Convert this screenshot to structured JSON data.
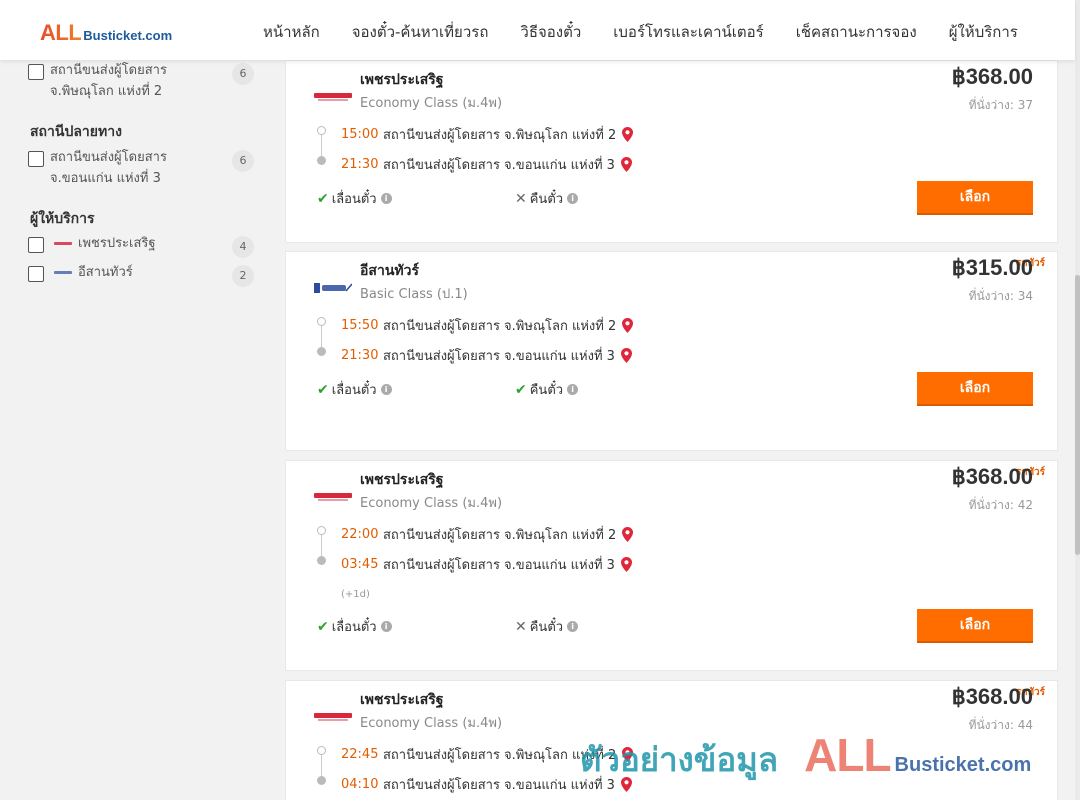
{
  "brand": {
    "logo_all": "ALL",
    "logo_rest": "Busticket.com"
  },
  "nav": [
    {
      "label": "หน้าหลัก"
    },
    {
      "label": "จองตั๋ว-ค้นหาเที่ยวรถ"
    },
    {
      "label": "วิธีจองตั๋ว"
    },
    {
      "label": "เบอร์โทรและเคาน์เตอร์"
    },
    {
      "label": "เช็คสถานะการจอง"
    },
    {
      "label": "ผู้ให้บริการ"
    }
  ],
  "sidebar": {
    "origin_item": {
      "line1": "สถานีขนส่งผู้โดยสาร",
      "line2": "จ.พิษณุโลก แห่งที่ 2",
      "count": "6"
    },
    "destination_heading": "สถานีปลายทาง",
    "destination_item": {
      "line1": "สถานีขนส่งผู้โดยสาร",
      "line2": "จ.ขอนแก่น แห่งที่ 3",
      "count": "6"
    },
    "operator_heading": "ผู้ให้บริการ",
    "operators": [
      {
        "label": "เพชรประเสริฐ",
        "count": "4",
        "logo_color": "#d0021b"
      },
      {
        "label": "อีสานทัวร์",
        "count": "2",
        "logo_color": "#2b4da0"
      }
    ]
  },
  "trips": [
    {
      "badge": "",
      "operator": "เพชรประเสริฐ",
      "class": "Economy Class (ม.4พ)",
      "price": "฿368.00",
      "seats": "ที่นั่งว่าง: 37",
      "depart_time": "15:00",
      "depart_place": "สถานีขนส่งผู้โดยสาร จ.พิษณุโลก แห่งที่ 2",
      "arrive_time": "21:30",
      "arrive_place": "สถานีขนส่งผู้โดยสาร จ.ขอนแก่น แห่งที่ 3",
      "next_day": "",
      "change_label": "เลื่อนตั๋ว",
      "change_ok": true,
      "refund_label": "คืนตั๋ว",
      "refund_ok": false,
      "select_label": "เลือก"
    },
    {
      "badge": "รถทัวร์",
      "operator": "อีสานทัวร์",
      "class": "Basic Class (ป.1)",
      "price": "฿315.00",
      "seats": "ที่นั่งว่าง: 34",
      "depart_time": "15:50",
      "depart_place": "สถานีขนส่งผู้โดยสาร จ.พิษณุโลก แห่งที่ 2",
      "arrive_time": "21:30",
      "arrive_place": "สถานีขนส่งผู้โดยสาร จ.ขอนแก่น แห่งที่ 3",
      "next_day": "",
      "change_label": "เลื่อนตั๋ว",
      "change_ok": true,
      "refund_label": "คืนตั๋ว",
      "refund_ok": true,
      "select_label": "เลือก"
    },
    {
      "badge": "รถทัวร์",
      "operator": "เพชรประเสริฐ",
      "class": "Economy Class (ม.4พ)",
      "price": "฿368.00",
      "seats": "ที่นั่งว่าง: 42",
      "depart_time": "22:00",
      "depart_place": "สถานีขนส่งผู้โดยสาร จ.พิษณุโลก แห่งที่ 2",
      "arrive_time": "03:45",
      "arrive_place": "สถานีขนส่งผู้โดยสาร จ.ขอนแก่น แห่งที่ 3",
      "next_day": "(+1d)",
      "change_label": "เลื่อนตั๋ว",
      "change_ok": true,
      "refund_label": "คืนตั๋ว",
      "refund_ok": false,
      "select_label": "เลือก"
    },
    {
      "badge": "รถทัวร์",
      "operator": "เพชรประเสริฐ",
      "class": "Economy Class (ม.4พ)",
      "price": "฿368.00",
      "seats": "ที่นั่งว่าง: 44",
      "depart_time": "22:45",
      "depart_place": "สถานีขนส่งผู้โดยสาร จ.พิษณุโลก แห่งที่ 2",
      "arrive_time": "04:10",
      "arrive_place": "สถานีขนส่งผู้โดยสาร จ.ขอนแก่น แห่งที่ 3",
      "next_day": "",
      "change_label": "",
      "change_ok": true,
      "refund_label": "",
      "refund_ok": false,
      "select_label": ""
    }
  ],
  "watermark": {
    "text": "ตัวอย่างข้อมูล",
    "all": "ALL",
    "rest": "Busticket.com"
  },
  "colors": {
    "accent": "#ff6d00",
    "time": "#e35d00",
    "ok": "#2ea12e",
    "pin": "#e0263a"
  }
}
